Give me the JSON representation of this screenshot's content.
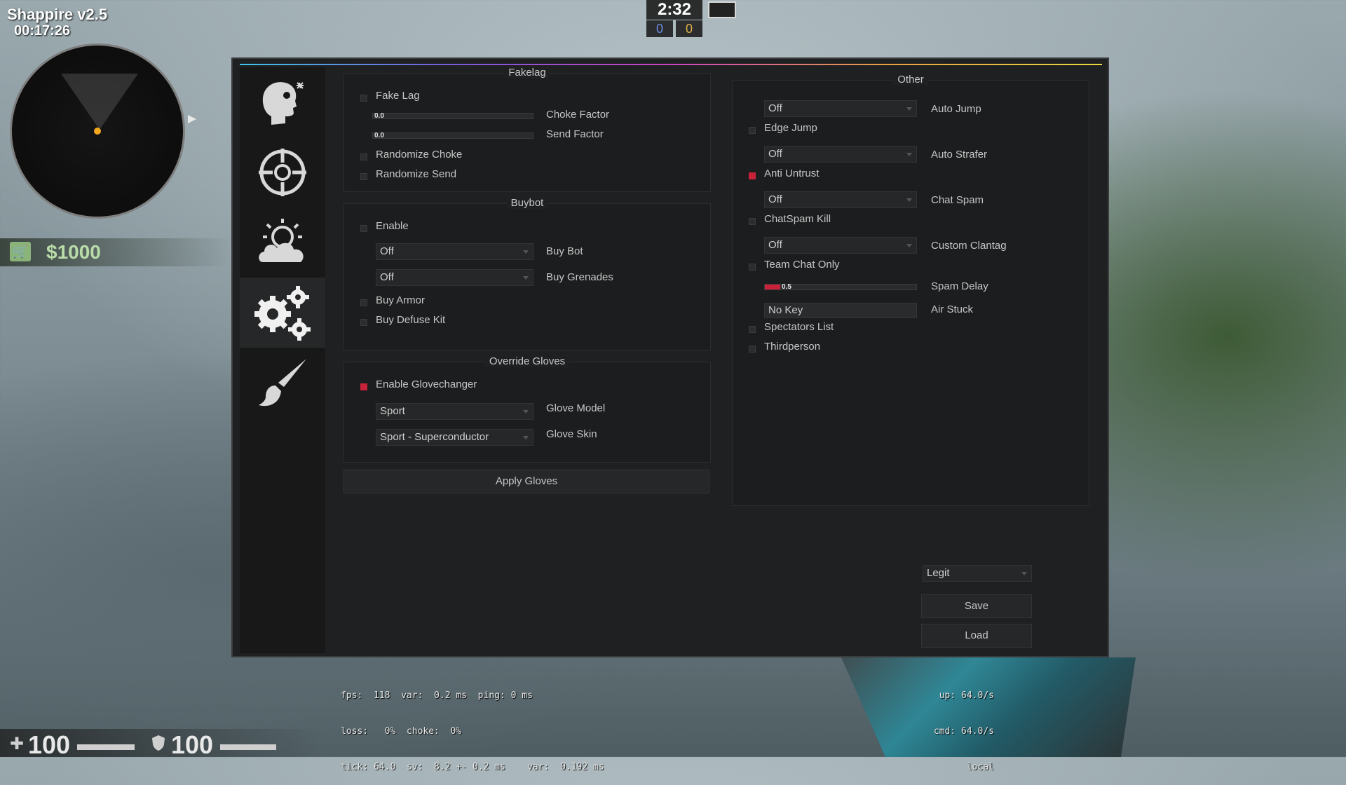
{
  "hud": {
    "cheat_title": "Shappire v2.5",
    "session_time": "00:17:26",
    "money": "$1000",
    "round_time": "2:32",
    "score_ct": "0",
    "score_t": "0",
    "health": "100",
    "armor": "100"
  },
  "sidebar": {
    "tabs": [
      {
        "icon": "head-target-icon"
      },
      {
        "icon": "crosshair-icon"
      },
      {
        "icon": "weather-sun-cloud-icon"
      },
      {
        "icon": "gears-icon",
        "active": true
      },
      {
        "icon": "paintbrush-icon"
      }
    ]
  },
  "fakelag": {
    "title": "Fakelag",
    "fake_lag": {
      "label": "Fake Lag",
      "checked": false
    },
    "choke_factor": {
      "label": "Choke Factor",
      "value": "0.0",
      "fill": 0
    },
    "send_factor": {
      "label": "Send Factor",
      "value": "0.0",
      "fill": 0
    },
    "randomize_choke": {
      "label": "Randomize Choke",
      "checked": false
    },
    "randomize_send": {
      "label": "Randomize Send",
      "checked": false
    }
  },
  "buybot": {
    "title": "Buybot",
    "enable": {
      "label": "Enable",
      "checked": false
    },
    "buy_bot": {
      "label": "Buy Bot",
      "value": "Off"
    },
    "buy_grenades": {
      "label": "Buy Grenades",
      "value": "Off"
    },
    "buy_armor": {
      "label": "Buy Armor",
      "checked": false
    },
    "buy_defuse_kit": {
      "label": "Buy Defuse Kit",
      "checked": false
    }
  },
  "gloves": {
    "title": "Override Gloves",
    "enable_glovechanger": {
      "label": "Enable Glovechanger",
      "checked": true
    },
    "glove_model": {
      "label": "Glove Model",
      "value": "Sport"
    },
    "glove_skin": {
      "label": "Glove Skin",
      "value": "Sport - Superconductor"
    },
    "apply_label": "Apply Gloves"
  },
  "other": {
    "title": "Other",
    "auto_jump": {
      "label": "Auto Jump",
      "value": "Off"
    },
    "edge_jump": {
      "label": "Edge Jump",
      "checked": false
    },
    "auto_strafer": {
      "label": "Auto Strafer",
      "value": "Off"
    },
    "anti_untrust": {
      "label": "Anti Untrust",
      "checked": true
    },
    "chat_spam": {
      "label": "Chat Spam",
      "value": "Off"
    },
    "chatspam_kill": {
      "label": "ChatSpam Kill",
      "checked": false
    },
    "custom_clantag": {
      "label": "Custom Clantag",
      "value": "Off"
    },
    "team_chat_only": {
      "label": "Team Chat Only",
      "checked": false
    },
    "spam_delay": {
      "label": "Spam Delay",
      "value": "0.5",
      "fill": 0.1
    },
    "air_stuck": {
      "label": "Air Stuck",
      "key": "No Key"
    },
    "spectators_list": {
      "label": "Spectators List",
      "checked": false
    },
    "thirdperson": {
      "label": "Thirdperson",
      "checked": false
    }
  },
  "config": {
    "selected": "Legit",
    "save_label": "Save",
    "load_label": "Load"
  },
  "netgraph": {
    "line1": "fps:  118  var:  0.2 ms  ping: 0 ms",
    "line2": "loss:   0%  choke:  0%",
    "line3": "tick: 64.0  sv:  8.2 +- 0.2 ms    var:  0.192 ms",
    "right1": "up: 64.0/s",
    "right2": "cmd: 64.0/s",
    "right3": "local"
  },
  "colors": {
    "accent": "#c8213a",
    "menu_bg": "#1f2021"
  }
}
